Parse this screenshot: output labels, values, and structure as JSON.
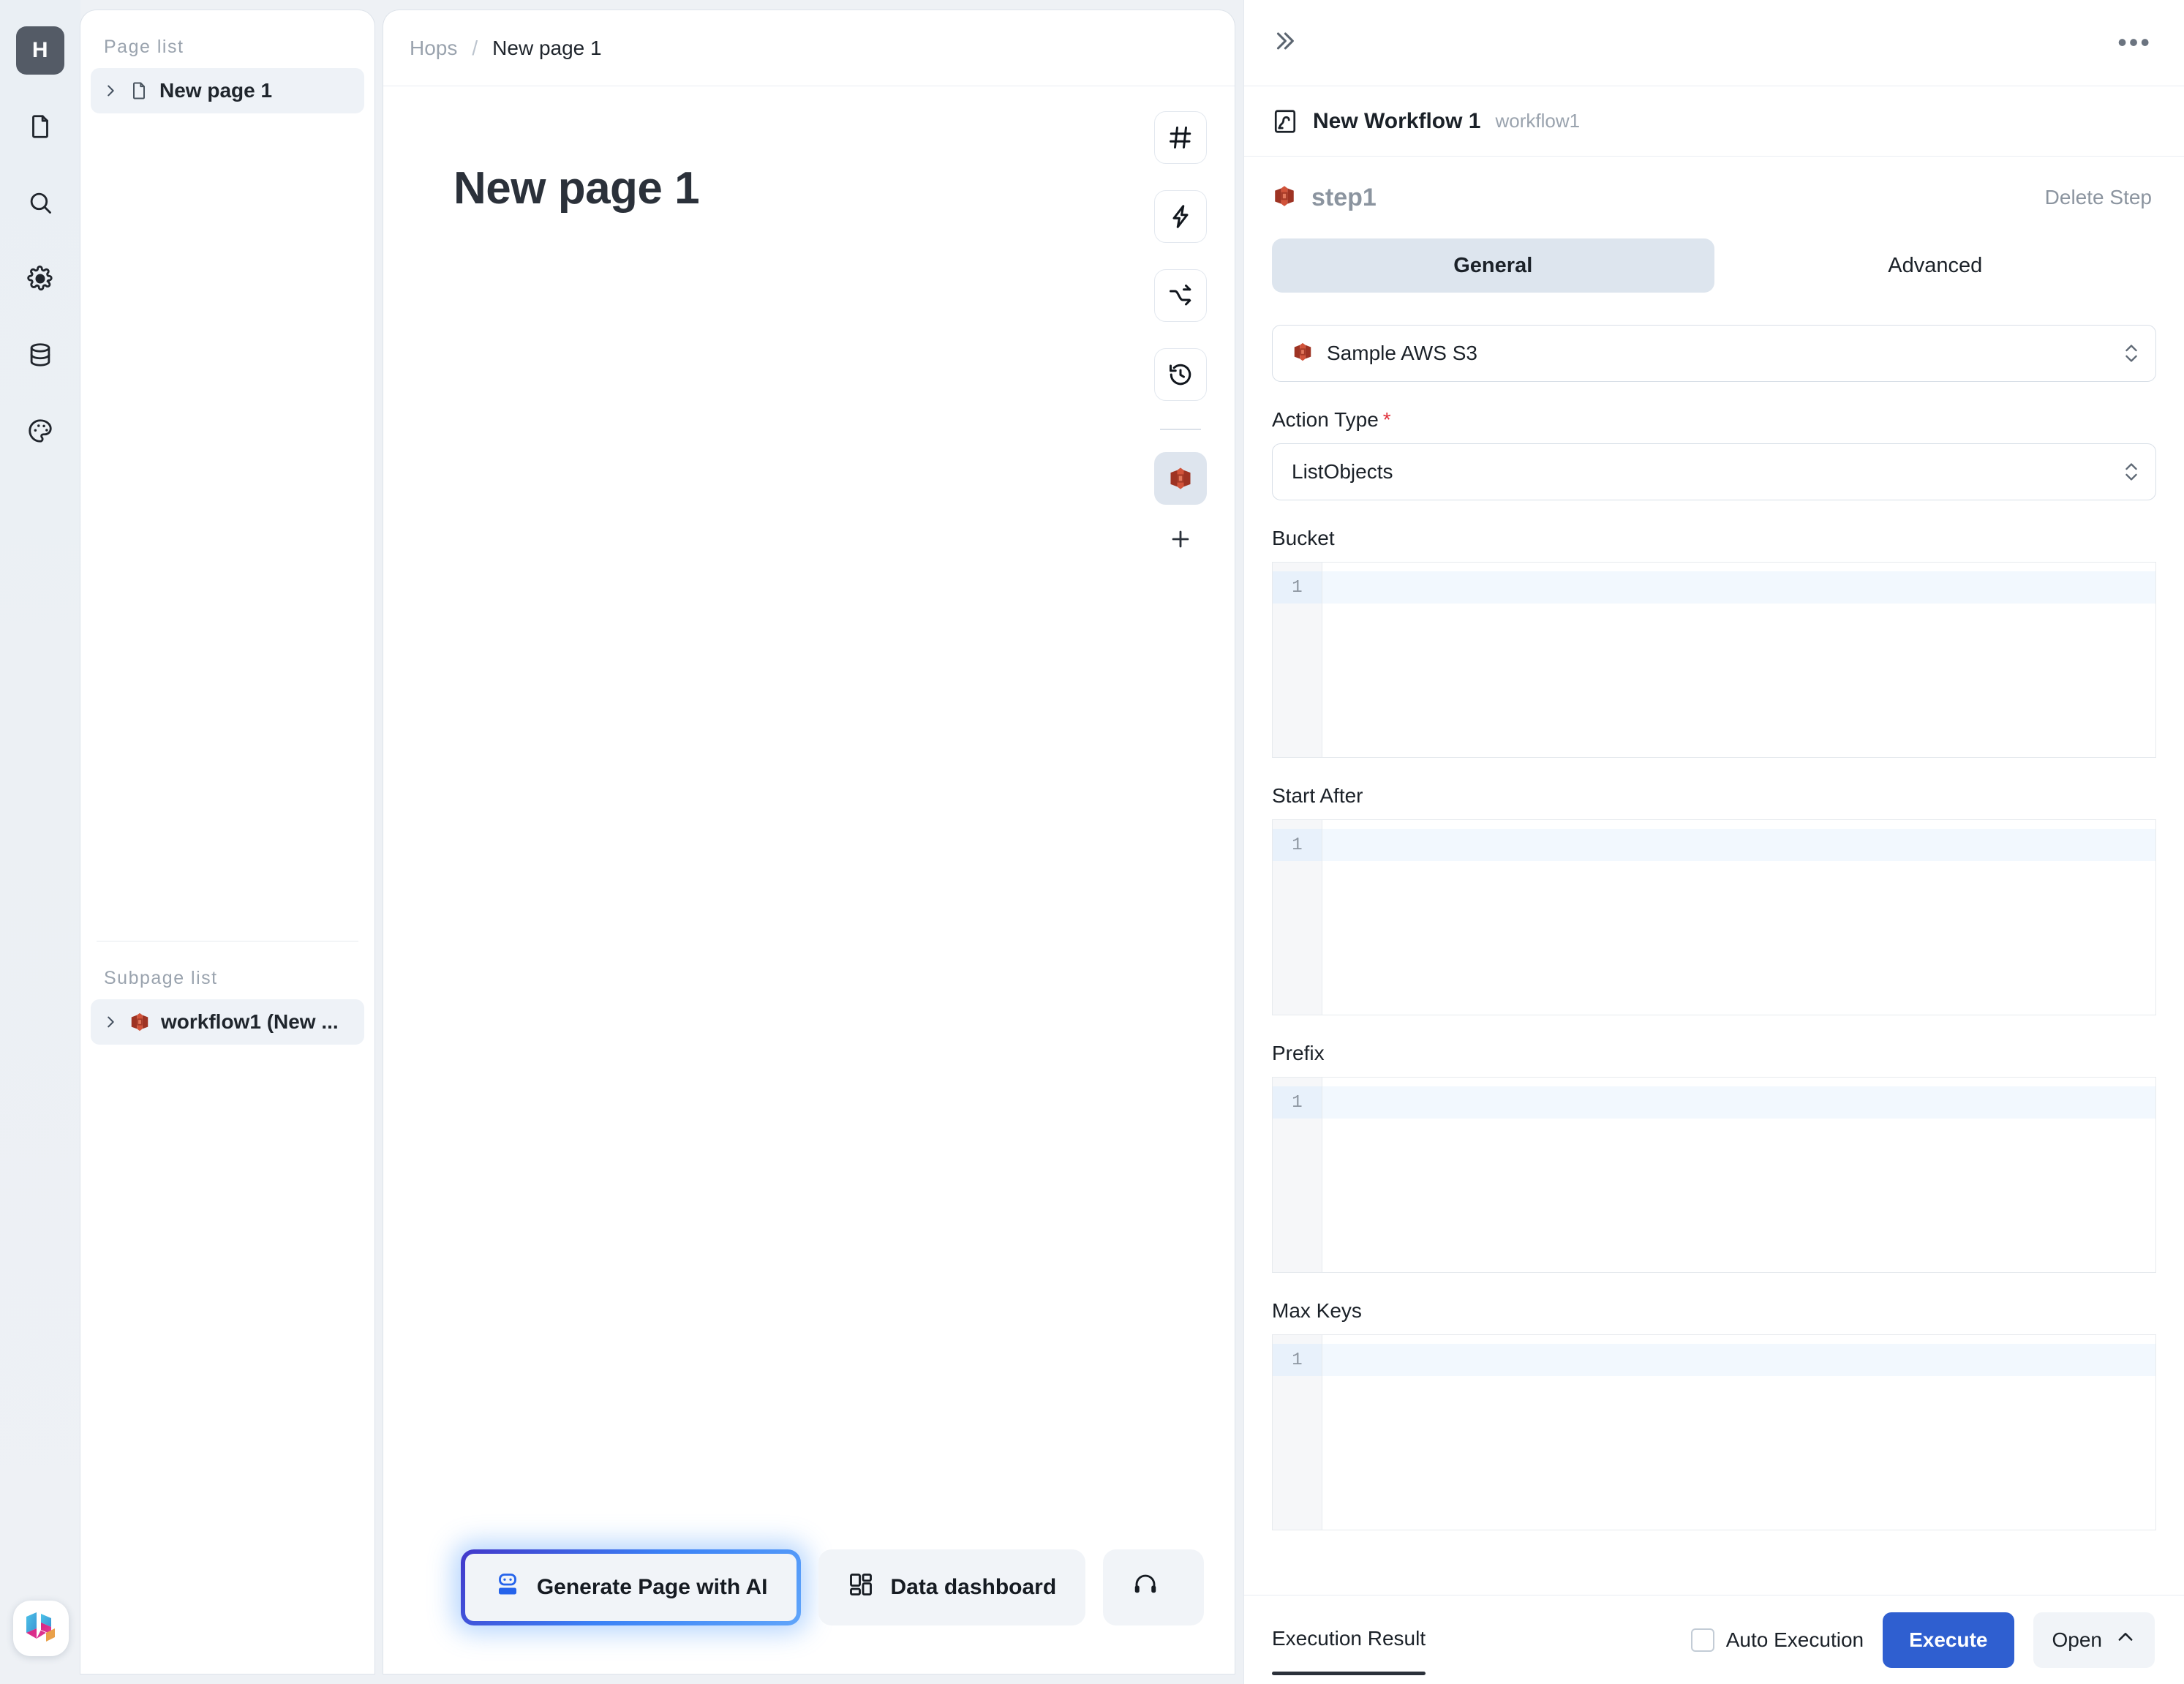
{
  "rail": {
    "logo_letter": "H",
    "icons": [
      {
        "name": "document-icon",
        "label": "Pages"
      },
      {
        "name": "search-icon",
        "label": "Search"
      },
      {
        "name": "gear-icon",
        "label": "Settings"
      },
      {
        "name": "database-icon",
        "label": "Data"
      },
      {
        "name": "palette-icon",
        "label": "Theme"
      }
    ],
    "bottom_logo_name": "hops-brand-logo"
  },
  "page_list": {
    "title": "Page list",
    "items": [
      {
        "label": "New page 1",
        "icon": "file-icon",
        "selected": true
      }
    ],
    "subpage_title": "Subpage list",
    "subpages": [
      {
        "label": "workflow1 (New ...",
        "icon": "aws-s3-icon",
        "selected": true
      }
    ]
  },
  "breadcrumb": {
    "root": "Hops",
    "separator": "/",
    "current": "New page 1"
  },
  "canvas": {
    "page_title": "New page 1",
    "tools": [
      {
        "name": "hash-icon",
        "label": "#",
        "active": false
      },
      {
        "name": "lightning-icon",
        "label": "Event",
        "active": false
      },
      {
        "name": "shuffle-icon",
        "label": "Branch",
        "active": false
      },
      {
        "name": "history-icon",
        "label": "History",
        "active": false
      },
      {
        "name": "aws-s3-icon",
        "label": "S3 Step",
        "active": true
      }
    ],
    "add_label": "+",
    "actions": [
      {
        "label": "Generate Page with AI",
        "icon": "robot-icon",
        "highlighted": true
      },
      {
        "label": "Data dashboard",
        "icon": "dashboard-icon",
        "highlighted": false
      },
      {
        "label": "",
        "icon": "support-headset-icon",
        "highlighted": false
      }
    ]
  },
  "right_panel": {
    "collapse_label": "»",
    "more_label": "•••",
    "workflow": {
      "icon": "workflow-icon",
      "name": "New Workflow 1",
      "id": "workflow1"
    },
    "step": {
      "icon": "aws-s3-icon",
      "name": "step1",
      "delete_label": "Delete Step"
    },
    "tabs": [
      {
        "label": "General",
        "active": true
      },
      {
        "label": "Advanced",
        "active": false
      }
    ],
    "connection": {
      "icon": "aws-s3-icon",
      "value": "Sample AWS S3"
    },
    "action_type": {
      "label": "Action Type",
      "required": true,
      "required_mark": "*",
      "value": "ListObjects"
    },
    "fields": [
      {
        "label": "Bucket",
        "line_number": "1",
        "value": ""
      },
      {
        "label": "Start After",
        "line_number": "1",
        "value": ""
      },
      {
        "label": "Prefix",
        "line_number": "1",
        "value": ""
      },
      {
        "label": "Max Keys",
        "line_number": "1",
        "value": ""
      }
    ],
    "bottom": {
      "exec_tab": "Execution Result",
      "auto_exec_label": "Auto Execution",
      "auto_exec_checked": false,
      "execute_label": "Execute",
      "open_label": "Open"
    }
  },
  "colors": {
    "accent_blue": "#2f5fd0",
    "s3_red": "#c8452d",
    "rail_logo_bg": "#545b66",
    "tab_active_bg": "#dde5ee",
    "required_red": "#e0303a"
  }
}
